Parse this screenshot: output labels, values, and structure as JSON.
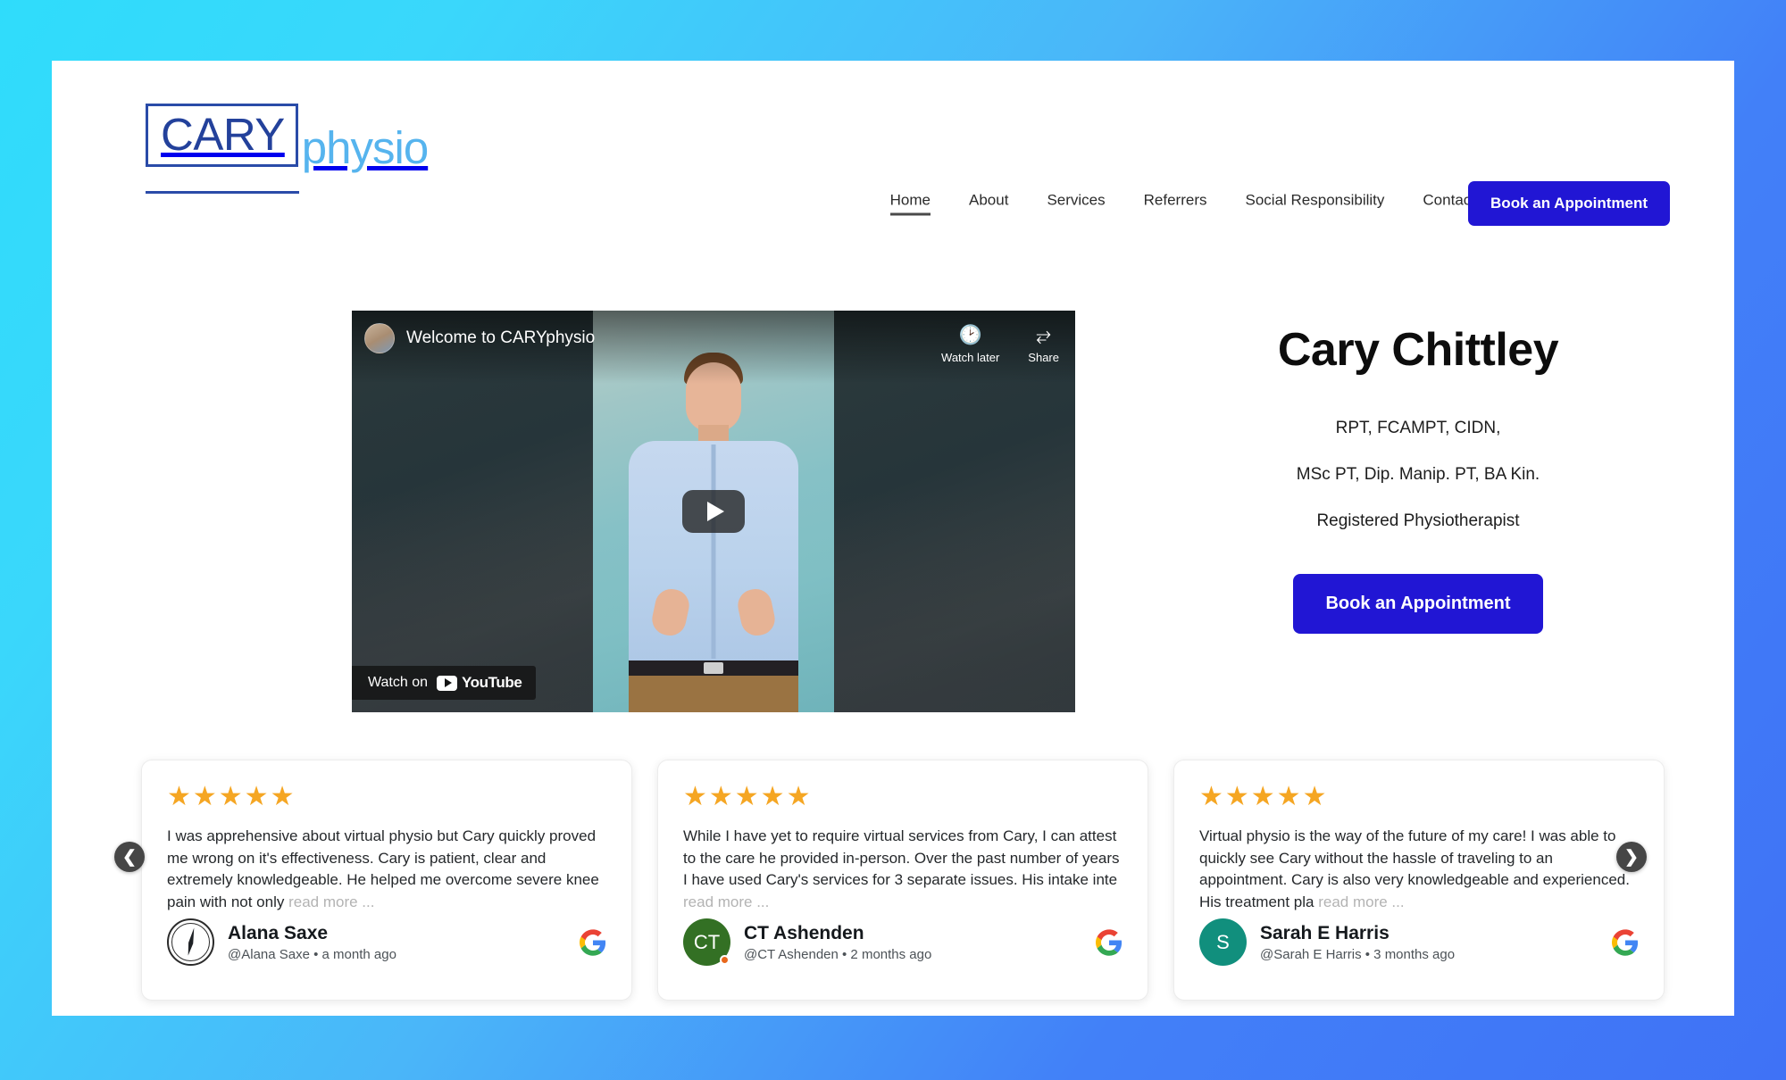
{
  "header": {
    "logo": {
      "primary": "CARY",
      "secondary": "physio"
    },
    "nav": [
      {
        "label": "Home",
        "active": true
      },
      {
        "label": "About",
        "active": false
      },
      {
        "label": "Services",
        "active": false
      },
      {
        "label": "Referrers",
        "active": false
      },
      {
        "label": "Social Responsibility",
        "active": false
      },
      {
        "label": "Contact",
        "active": false
      }
    ],
    "cta_label": "Book an Appointment"
  },
  "video": {
    "title": "Welcome to CARYphysio",
    "watch_later_label": "Watch later",
    "watch_later_icon": "clock-icon",
    "share_label": "Share",
    "share_icon": "share-arrow-icon",
    "play_icon": "play-icon",
    "watch_on_label": "Watch on",
    "youtube_wordmark": "YouTube"
  },
  "hero": {
    "name": "Cary Chittley",
    "credential_1": "RPT, FCAMPT, CIDN,",
    "credential_2": "MSc PT, Dip. Manip. PT, BA Kin.",
    "credential_3": "Registered Physiotherapist",
    "cta_label": "Book an Appointment"
  },
  "reviews": {
    "prev_icon": "chevron-left-icon",
    "next_icon": "chevron-right-icon",
    "read_more_label": "read more ...",
    "items": [
      {
        "stars": "★★★★★",
        "rating": 5,
        "text": "I was apprehensive about virtual physio but Cary quickly proved me wrong on it's effectiveness. Cary is patient, clear and extremely knowledgeable. He helped me overcome severe knee pain with not only ",
        "author": "Alana Saxe",
        "handle": "@Alana Saxe • a month ago",
        "avatar_initial": "",
        "avatar_type": "camp-logo",
        "avatar_color": "#ffffff",
        "source_icon": "google-icon"
      },
      {
        "stars": "★★★★★",
        "rating": 5,
        "text": "While I have yet to require virtual services from Cary, I can attest to the care he provided in-person. Over the past number of years I have used Cary's services for 3 separate issues. His intake inte ",
        "author": "CT Ashenden",
        "handle": "@CT Ashenden • 2 months ago",
        "avatar_initial": "CT",
        "avatar_type": "initials",
        "avatar_color": "#337024",
        "source_icon": "google-icon"
      },
      {
        "stars": "★★★★★",
        "rating": 5,
        "text": "Virtual physio is the way of the future of my care! I was able to quickly see Cary without the hassle of traveling to an appointment. Cary is also very knowledgeable and experienced. His treatment pla ",
        "author": "Sarah E Harris",
        "handle": "@Sarah E Harris • 3 months ago",
        "avatar_initial": "S",
        "avatar_type": "initials",
        "avatar_color": "#118f7d",
        "source_icon": "google-icon"
      }
    ]
  },
  "colors": {
    "brand_blue": "#2116d4",
    "logo_dark_blue": "#23419b",
    "logo_light_blue": "#56b4ee",
    "star_gold": "#f5a623",
    "bg_gradient_start": "#2fdcfb",
    "bg_gradient_end": "#3f72f6"
  }
}
